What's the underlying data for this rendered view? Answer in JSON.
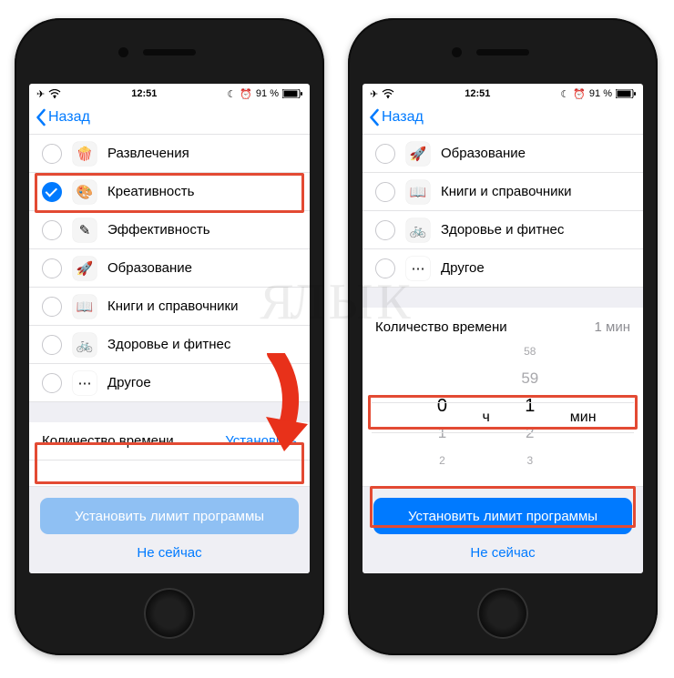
{
  "status": {
    "time": "12:51",
    "battery": "91 %"
  },
  "nav": {
    "back": "Назад"
  },
  "left": {
    "categories": [
      {
        "key": "entertainment",
        "label": "Развлечения",
        "icon": "🍿",
        "checked": false
      },
      {
        "key": "creativity",
        "label": "Креативность",
        "icon": "🎨",
        "checked": true
      },
      {
        "key": "productivity",
        "label": "Эффективность",
        "icon": "✎",
        "checked": false
      },
      {
        "key": "education",
        "label": "Образование",
        "icon": "🚀",
        "checked": false
      },
      {
        "key": "books",
        "label": "Книги и справочники",
        "icon": "📖",
        "checked": false
      },
      {
        "key": "health",
        "label": "Здоровье и фитнес",
        "icon": "🚲",
        "checked": false
      },
      {
        "key": "other",
        "label": "Другое",
        "icon": "⋯",
        "checked": false
      }
    ],
    "time_section_label": "Количество времени",
    "time_action": "Установить",
    "primary_button": "Установить лимит программы",
    "secondary_button": "Не сейчас"
  },
  "right": {
    "categories": [
      {
        "key": "education",
        "label": "Образование",
        "icon": "🚀",
        "checked": false
      },
      {
        "key": "books",
        "label": "Книги и справочники",
        "icon": "📖",
        "checked": false
      },
      {
        "key": "health",
        "label": "Здоровье и фитнес",
        "icon": "🚲",
        "checked": false
      },
      {
        "key": "other",
        "label": "Другое",
        "icon": "⋯",
        "checked": false
      }
    ],
    "time_section_label": "Количество времени",
    "time_value": "1 мин",
    "picker": {
      "hours_above": "",
      "hours_sel": "0",
      "hours_below1": "1",
      "hours_below2": "2",
      "hours_unit": "ч",
      "min_above2": "58",
      "min_above1": "59",
      "min_sel": "1",
      "min_below1": "2",
      "min_below2": "3",
      "min_unit": "мин"
    },
    "primary_button": "Установить лимит программы",
    "secondary_button": "Не сейчас"
  },
  "watermark": "ЯБЛЫК"
}
